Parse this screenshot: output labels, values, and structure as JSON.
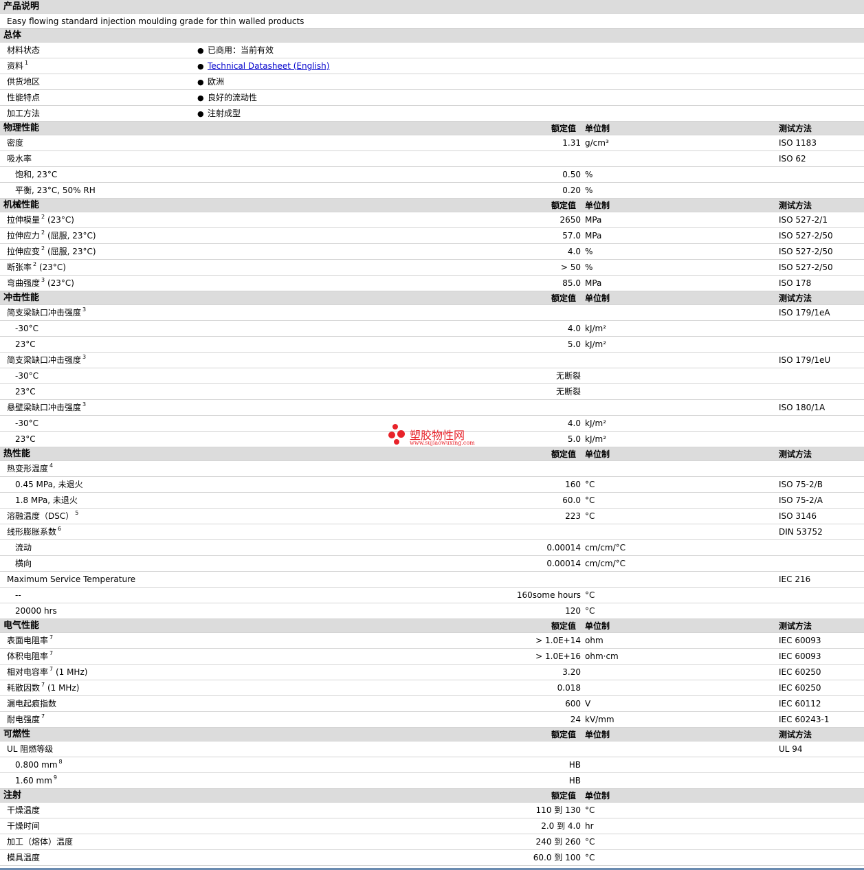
{
  "header": {
    "value_col": "额定值",
    "unit_col": "单位制",
    "method_col": "测试方法"
  },
  "product_description": {
    "title": "产品说明",
    "text": "Easy flowing standard injection moulding grade for thin walled products"
  },
  "general": {
    "title": "总体",
    "rows": [
      {
        "label": "材料状态",
        "value": "已商用：当前有效"
      },
      {
        "label": "资料",
        "sup": "1",
        "value": "Technical Datasheet (English)",
        "link": true
      },
      {
        "label": "供货地区",
        "value": "欧洲"
      },
      {
        "label": "性能特点",
        "value": "良好的流动性"
      },
      {
        "label": "加工方法",
        "value": "注射成型"
      }
    ]
  },
  "sections": [
    {
      "title": "物理性能",
      "rows": [
        {
          "label": "密度",
          "value": "1.31",
          "unit": "g/cm³",
          "method": "ISO 1183"
        },
        {
          "label": "吸水率",
          "method": "ISO 62"
        },
        {
          "label": "饱和, 23°C",
          "indent": true,
          "value": "0.50",
          "unit": "%"
        },
        {
          "label": "平衡, 23°C, 50% RH",
          "indent": true,
          "value": "0.20",
          "unit": "%"
        }
      ]
    },
    {
      "title": "机械性能",
      "rows": [
        {
          "label": "拉伸模量",
          "sup": "2",
          "suffix": "(23°C)",
          "value": "2650",
          "unit": "MPa",
          "method": "ISO 527-2/1"
        },
        {
          "label": "拉伸应力",
          "sup": "2",
          "suffix": "(屈服, 23°C)",
          "value": "57.0",
          "unit": "MPa",
          "method": "ISO 527-2/50"
        },
        {
          "label": "拉伸应变",
          "sup": "2",
          "suffix": "(屈服, 23°C)",
          "value": "4.0",
          "unit": "%",
          "method": "ISO 527-2/50"
        },
        {
          "label": "断张率",
          "sup": "2",
          "suffix": "(23°C)",
          "value": "> 50",
          "unit": "%",
          "method": "ISO 527-2/50"
        },
        {
          "label": "弯曲强度",
          "sup": "3",
          "suffix": "(23°C)",
          "value": "85.0",
          "unit": "MPa",
          "method": "ISO 178"
        }
      ]
    },
    {
      "title": "冲击性能",
      "rows": [
        {
          "label": "简支梁缺口冲击强度",
          "sup": "3",
          "method": "ISO 179/1eA"
        },
        {
          "label": "-30°C",
          "indent": true,
          "value": "4.0",
          "unit": "kJ/m²"
        },
        {
          "label": "23°C",
          "indent": true,
          "value": "5.0",
          "unit": "kJ/m²"
        },
        {
          "label": "简支梁缺口冲击强度",
          "sup": "3",
          "method": "ISO 179/1eU"
        },
        {
          "label": "-30°C",
          "indent": true,
          "value": "无断裂"
        },
        {
          "label": "23°C",
          "indent": true,
          "value": "无断裂"
        },
        {
          "label": "悬壁梁缺口冲击强度",
          "sup": "3",
          "method": "ISO 180/1A"
        },
        {
          "label": "-30°C",
          "indent": true,
          "value": "4.0",
          "unit": "kJ/m²"
        },
        {
          "label": "23°C",
          "indent": true,
          "value": "5.0",
          "unit": "kJ/m²"
        }
      ]
    },
    {
      "title": "热性能",
      "rows": [
        {
          "label": "热变形温度",
          "sup": "4"
        },
        {
          "label": "0.45 MPa, 未退火",
          "indent": true,
          "value": "160",
          "unit": "°C",
          "method": "ISO 75-2/B"
        },
        {
          "label": "1.8 MPa, 未退火",
          "indent": true,
          "value": "60.0",
          "unit": "°C",
          "method": "ISO 75-2/A"
        },
        {
          "label": "溶融温度（DSC）",
          "sup": "5",
          "value": "223",
          "unit": "°C",
          "method": "ISO 3146"
        },
        {
          "label": "线形膨胀系数",
          "sup": "6",
          "method": "DIN 53752"
        },
        {
          "label": "流动",
          "indent": true,
          "value": "0.00014",
          "unit": "cm/cm/°C"
        },
        {
          "label": "横向",
          "indent": true,
          "value": "0.00014",
          "unit": "cm/cm/°C"
        },
        {
          "label": "Maximum Service Temperature",
          "method": "IEC 216"
        },
        {
          "label": "--",
          "indent": true,
          "value": "160some hours",
          "unit": "°C"
        },
        {
          "label": "20000 hrs",
          "indent": true,
          "value": "120",
          "unit": "°C"
        }
      ]
    },
    {
      "title": "电气性能",
      "rows": [
        {
          "label": "表面电阻率",
          "sup": "7",
          "value": "> 1.0E+14",
          "unit": "ohm",
          "method": "IEC 60093"
        },
        {
          "label": "体积电阻率",
          "sup": "7",
          "value": "> 1.0E+16",
          "unit": "ohm·cm",
          "method": "IEC 60093"
        },
        {
          "label": "相对电容率",
          "sup": "7",
          "suffix": "(1 MHz)",
          "value": "3.20",
          "method": "IEC 60250"
        },
        {
          "label": "耗散因数",
          "sup": "7",
          "suffix": "(1 MHz)",
          "value": "0.018",
          "method": "IEC 60250"
        },
        {
          "label": "漏电起痕指数",
          "value": "600",
          "unit": "V",
          "method": "IEC 60112"
        },
        {
          "label": "耐电强度",
          "sup": "7",
          "value": "24",
          "unit": "kV/mm",
          "method": "IEC 60243-1"
        }
      ]
    },
    {
      "title": "可燃性",
      "rows": [
        {
          "label": "UL 阻燃等级",
          "method": "UL 94"
        },
        {
          "label": "0.800 mm",
          "sup": "8",
          "indent": true,
          "value": "HB"
        },
        {
          "label": "1.60 mm",
          "sup": "9",
          "indent": true,
          "value": "HB"
        }
      ]
    },
    {
      "title": "注射",
      "no_method_header": true,
      "rows": [
        {
          "label": "干燥温度",
          "value": "110 到  130",
          "unit": "°C"
        },
        {
          "label": "干燥时间",
          "value": "2.0 到  4.0",
          "unit": "hr"
        },
        {
          "label": "加工（熔体）温度",
          "value": "240 到  260",
          "unit": "°C"
        },
        {
          "label": "模具温度",
          "value": "60.0 到  100",
          "unit": "°C"
        }
      ]
    }
  ],
  "watermark": {
    "title": "塑胶物性网",
    "url": "www.sujiaowuxing.com",
    "color": "#e8232a"
  }
}
